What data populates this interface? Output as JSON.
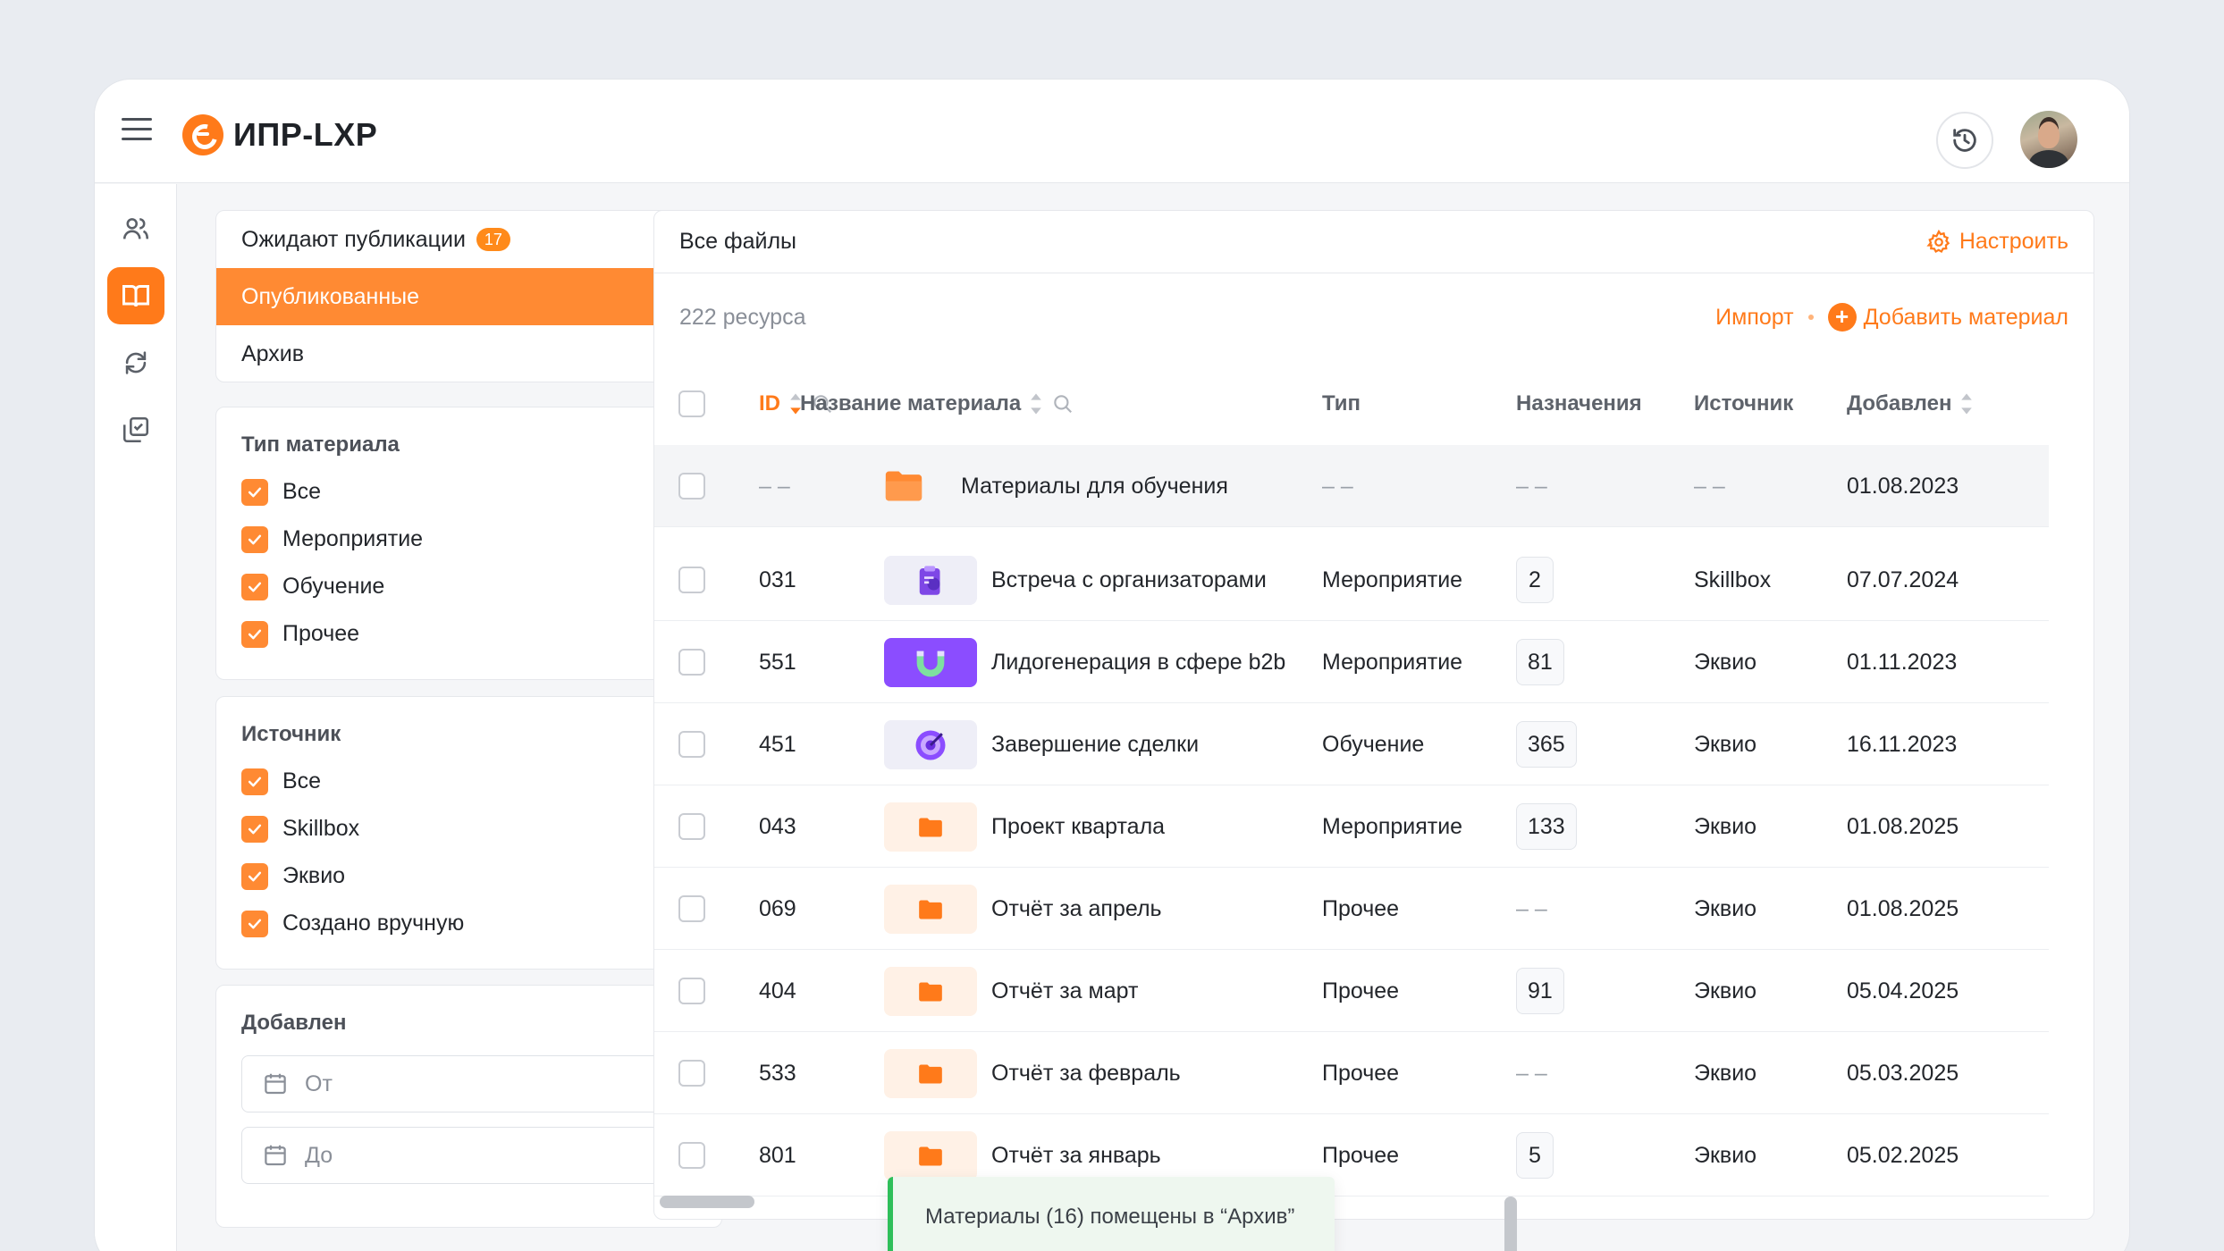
{
  "app": {
    "title": "ИПР-LXP"
  },
  "status_tabs": [
    {
      "label": "Ожидают публикации",
      "count": "17"
    },
    {
      "label": "Опубликованные",
      "active": true
    },
    {
      "label": "Архив"
    }
  ],
  "filters": {
    "type": {
      "title": "Тип материала",
      "options": [
        "Все",
        "Мероприятие",
        "Обучение",
        "Прочее"
      ]
    },
    "source": {
      "title": "Источник",
      "options": [
        "Все",
        "Skillbox",
        "Эквио",
        "Создано вручную"
      ]
    },
    "added": {
      "title": "Добавлен",
      "from_placeholder": "От",
      "to_placeholder": "До"
    }
  },
  "main": {
    "title": "Все файлы",
    "configure_label": "Настроить",
    "resource_count": "222 ресурса",
    "import_label": "Импорт",
    "add_label": "Добавить материал",
    "columns": {
      "id": "ID",
      "name": "Название материала",
      "type": "Тип",
      "assignments": "Назначения",
      "source": "Источник",
      "added": "Добавлен"
    },
    "folder_row": {
      "id": "– –",
      "name": "Материалы для обучения",
      "type": "– –",
      "assignments": "– –",
      "source": "– –",
      "added": "01.08.2023"
    },
    "rows": [
      {
        "id": "031",
        "name": "Встреча с организаторами",
        "type": "Мероприятие",
        "assignments": "2",
        "source": "Skillbox",
        "added": "07.07.2024",
        "thumb": "clipboard-icon"
      },
      {
        "id": "551",
        "name": "Лидогенерация в сфере b2b",
        "type": "Мероприятие",
        "assignments": "81",
        "source": "Эквио",
        "added": "01.11.2023",
        "thumb": "magnet-icon"
      },
      {
        "id": "451",
        "name": "Завершение сделки",
        "type": "Обучение",
        "assignments": "365",
        "source": "Эквио",
        "added": "16.11.2023",
        "thumb": "target-icon"
      },
      {
        "id": "043",
        "name": "Проект квартала",
        "type": "Мероприятие",
        "assignments": "133",
        "source": "Эквио",
        "added": "01.08.2025",
        "thumb": "folder-icon"
      },
      {
        "id": "069",
        "name": "Отчёт за апрель",
        "type": "Прочее",
        "assignments": "– –",
        "source": "Эквио",
        "added": "01.08.2025",
        "thumb": "folder-icon"
      },
      {
        "id": "404",
        "name": "Отчёт за март",
        "type": "Прочее",
        "assignments": "91",
        "source": "Эквио",
        "added": "05.04.2025",
        "thumb": "folder-icon"
      },
      {
        "id": "533",
        "name": "Отчёт за февраль",
        "type": "Прочее",
        "assignments": "– –",
        "source": "Эквио",
        "added": "05.03.2025",
        "thumb": "folder-icon"
      },
      {
        "id": "801",
        "name": "Отчёт за январь",
        "type": "Прочее",
        "assignments": "5",
        "source": "Эквио",
        "added": "05.02.2025",
        "thumb": "folder-icon"
      }
    ]
  },
  "toast": {
    "message": "Материалы (16) помещены в “Архив”"
  },
  "colors": {
    "accent": "#ff7a1a",
    "success": "#2fbf5a"
  }
}
